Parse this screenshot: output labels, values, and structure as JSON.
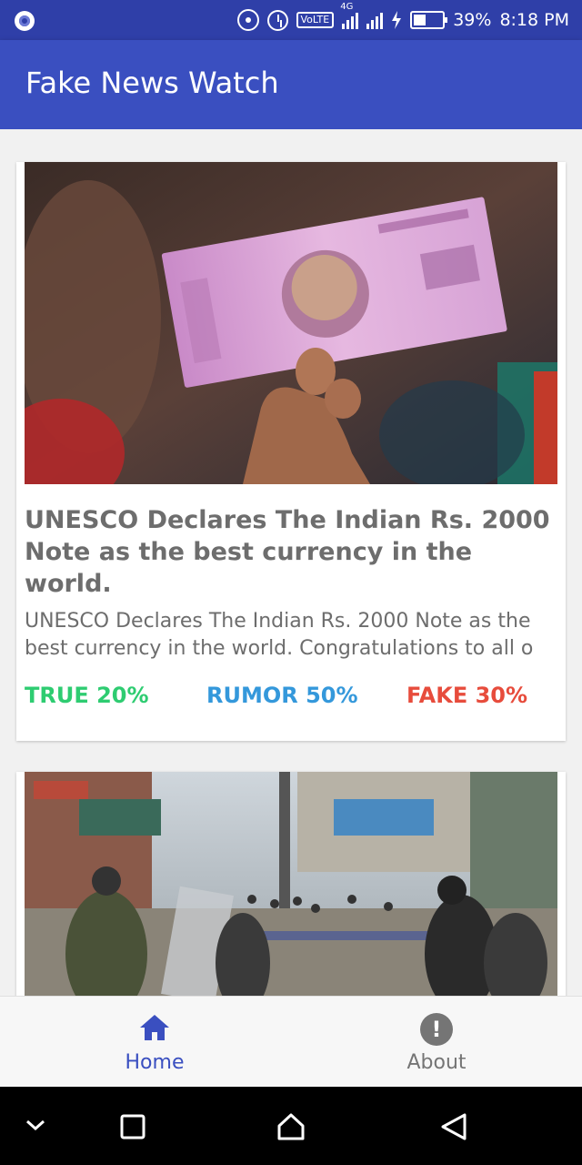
{
  "status_bar": {
    "network": "4G",
    "volte": "VoLTE",
    "battery": "39%",
    "time": "8:18 PM",
    "icons": [
      "notification-icon",
      "hotspot-icon",
      "alarm-icon",
      "volte-icon",
      "signal-icon",
      "charging-icon",
      "battery-icon"
    ]
  },
  "app_bar": {
    "title": "Fake News Watch"
  },
  "feed": [
    {
      "image": "rs-2000-note-photo",
      "headline": "UNESCO Declares The Indian Rs. 2000 Note as the best currency in the world.",
      "description": "UNESCO Declares The Indian Rs. 2000 Note as the best currency in the world. Congratulations to all o",
      "stats": {
        "true_label": "TRUE 20%",
        "rumor_label": "RUMOR 50%",
        "fake_label": "FAKE 30%",
        "true_pct": 20,
        "rumor_pct": 50,
        "fake_pct": 30
      }
    },
    {
      "image": "street-clash-photo"
    }
  ],
  "bottom_nav": {
    "items": [
      {
        "label": "Home",
        "icon": "home-icon",
        "selected": true
      },
      {
        "label": "About",
        "icon": "info-icon",
        "selected": false
      }
    ]
  },
  "colors": {
    "status_bar": "#2f3fa8",
    "app_bar": "#3a4fc0",
    "true": "#2ecc71",
    "rumor": "#3498db",
    "fake": "#e74c3c",
    "nav_active": "#3a4fc0",
    "nav_inactive": "#757575"
  }
}
